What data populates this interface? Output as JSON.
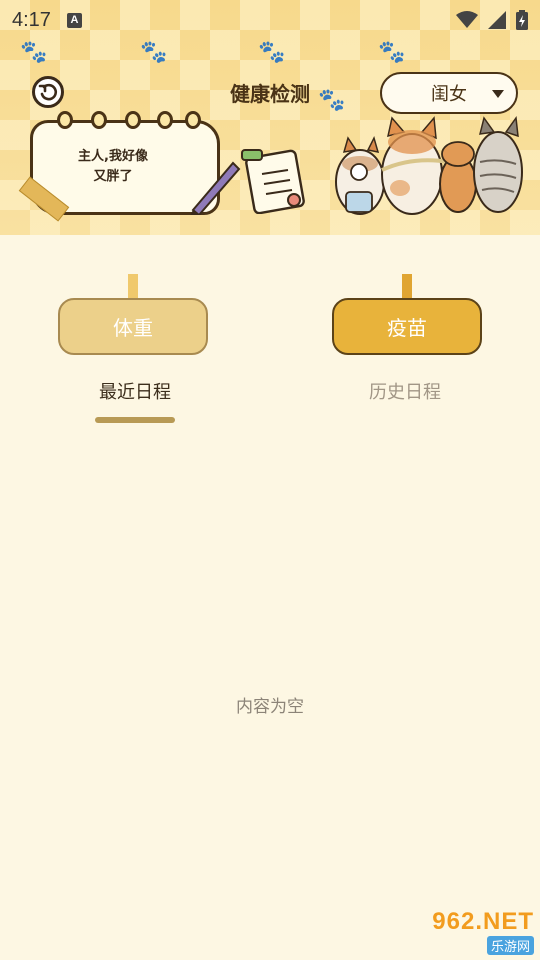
{
  "status_bar": {
    "time": "4:17",
    "indicator": "A"
  },
  "header": {
    "title": "健康检测",
    "gender_selected": "闺女",
    "note_line1": "主人,我好像",
    "note_line2": "又胖了"
  },
  "tabs": {
    "weight_label": "体重",
    "vaccine_label": "疫苗"
  },
  "subtabs": {
    "recent_label": "最近日程",
    "history_label": "历史日程"
  },
  "content": {
    "empty_text": "内容为空"
  },
  "watermark": {
    "top": "962.NET",
    "bottom": "乐游网"
  },
  "colors": {
    "background": "#fdf7e3",
    "accent": "#e8b33b",
    "text_dark": "#4a3316"
  },
  "icons": [
    "back-icon",
    "caret-down-icon",
    "wifi-icon",
    "signal-icon",
    "battery-icon",
    "paw-icon",
    "pen-icon",
    "clipboard-icon"
  ]
}
